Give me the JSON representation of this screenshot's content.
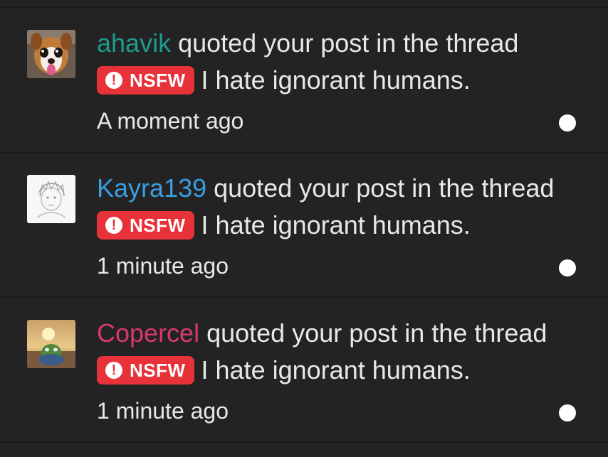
{
  "notifications": [
    {
      "username": "ahavik",
      "username_color": "#1f9b8e",
      "action": " quoted your post in the thread",
      "badge_icon": "!",
      "badge_label": "NSFW",
      "badge_color": "#e8323a",
      "thread_title": "I hate ignorant humans.",
      "time": "A moment ago",
      "avatar_icon": "dog-avatar"
    },
    {
      "username": "Kayra139",
      "username_color": "#3a9ee0",
      "action": " quoted your post in the thread",
      "badge_icon": "!",
      "badge_label": "NSFW",
      "badge_color": "#e8323a",
      "thread_title": "I hate ignorant humans.",
      "time": "1 minute ago",
      "avatar_icon": "sketch-avatar"
    },
    {
      "username": "Copercel",
      "username_color": "#d63a6a",
      "action": " quoted your post in the thread",
      "badge_icon": "!",
      "badge_label": "NSFW",
      "badge_color": "#e8323a",
      "thread_title": "I hate ignorant humans.",
      "time": "1 minute ago",
      "avatar_icon": "sunset-frog-avatar"
    }
  ]
}
